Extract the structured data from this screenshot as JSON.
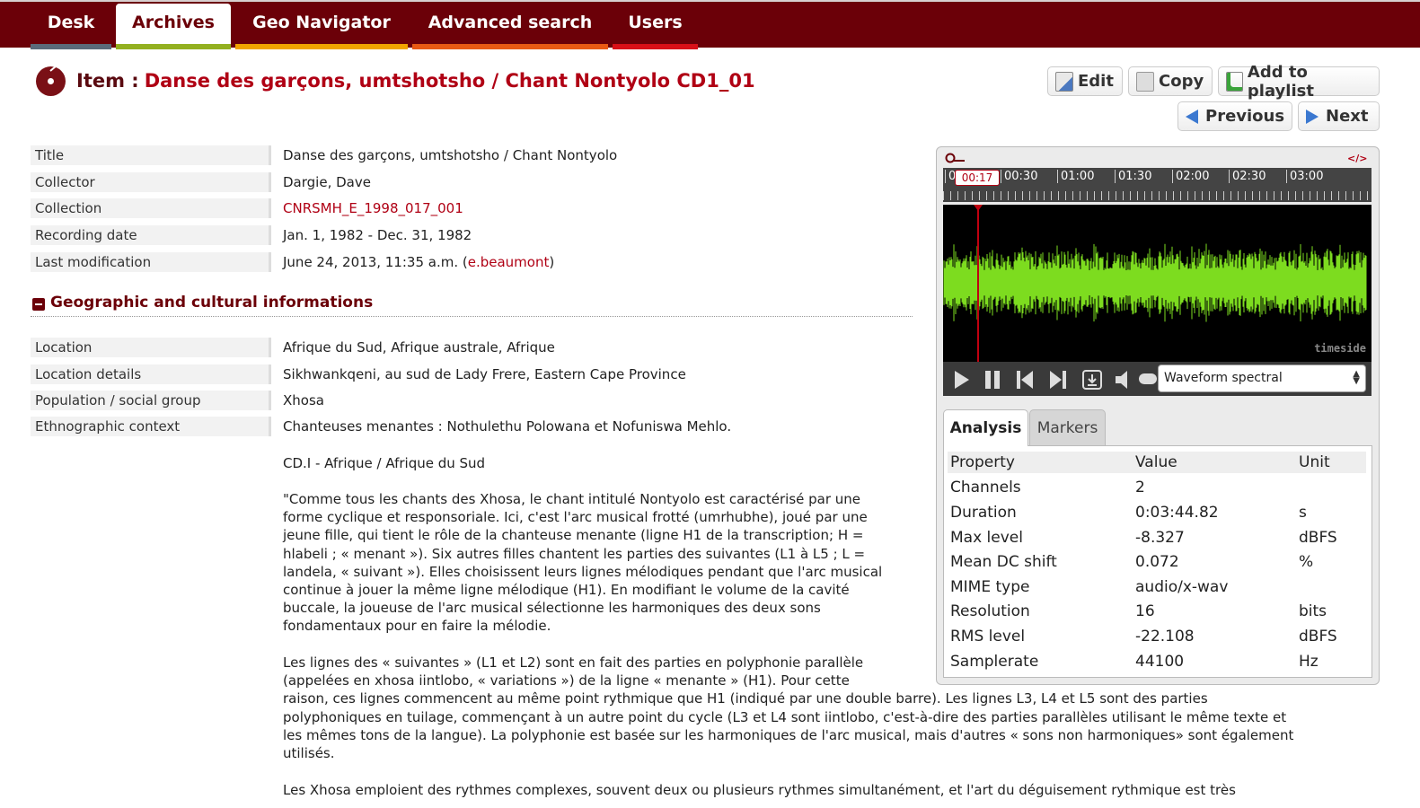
{
  "nav": {
    "tabs": [
      {
        "label": "Desk",
        "color": "#5b6b7b"
      },
      {
        "label": "Archives",
        "color": "#93b020"
      },
      {
        "label": "Geo Navigator",
        "color": "#f0a400"
      },
      {
        "label": "Advanced search",
        "color": "#e85a14"
      },
      {
        "label": "Users",
        "color": "#d81018"
      }
    ]
  },
  "item": {
    "label": "Item :",
    "title": "Danse des garçons, umtshotsho / Chant Nontyolo CD1_01"
  },
  "actions": {
    "edit": "Edit",
    "copy": "Copy",
    "add_to_playlist": "Add to playlist",
    "previous": "Previous",
    "next": "Next"
  },
  "metadata": [
    {
      "key": "Title",
      "value": "Danse des garçons, umtshotsho / Chant Nontyolo"
    },
    {
      "key": "Collector",
      "value": "Dargie, Dave"
    },
    {
      "key": "Collection",
      "value": "CNRSMH_E_1998_017_001"
    },
    {
      "key": "Recording date",
      "value": "Jan. 1, 1982 - Dec. 31, 1982"
    },
    {
      "key": "Last modification",
      "value_prefix": "June 24, 2013, 11:35 a.m. (",
      "value_link": "e.beaumont",
      "value_suffix": ")"
    }
  ],
  "geo_section": {
    "title": "Geographic and cultural informations",
    "rows": [
      {
        "key": "Location",
        "value": "Afrique du Sud, Afrique australe, Afrique"
      },
      {
        "key": "Location details",
        "value": "Sikhwankqeni, au sud de Lady Frere, Eastern Cape Province"
      },
      {
        "key": "Population / social group",
        "value": "Xhosa"
      },
      {
        "key": "Ethnographic context",
        "value": "Chanteuses menantes : Nothulethu Polowana et Nofuniswa Mehlo."
      }
    ]
  },
  "description": {
    "p1": "CD.I - Afrique / Afrique du Sud",
    "p2": [
      "\"Comme tous les chants des Xhosa, le chant intitulé Nontyolo est caractérisé par une",
      "forme cyclique et responsoriale. Ici, c'est l'arc musical frotté (umrhubhe), joué par une",
      "jeune fille, qui tient le rôle de la chanteuse menante (ligne H1 de la transcription; H =",
      "hlabeli ; « menant »). Six autres filles chantent les parties des suivantes (L1 à L5 ; L =",
      "landela, « suivant »). Elles choisissent leurs lignes mélodiques pendant que l'arc musical",
      "continue à jouer la même ligne mélodique (H1). En modifiant le volume de la cavité",
      "buccale, la joueuse de l'arc musical sélectionne les harmoniques des deux sons",
      "fondamentaux pour en faire la mélodie."
    ],
    "p3": [
      "Les lignes des « suivantes » (L1 et L2) sont en fait des parties en polyphonie parallèle",
      "(appelées en xhosa iintlobo, « variations ») de la ligne « menante » (H1). Pour cette",
      "raison, ces lignes commencent au même point rythmique que H1 (indiqué par une double barre). Les lignes L3, L4 et L5 sont des parties",
      "polyphoniques en tuilage, commençant à un autre point du cycle (L3 et L4 sont iintlobo, c'est-à-dire des parties parallèles utilisant le même texte et",
      "les mêmes tons de la langue). La polyphonie est basée sur les harmoniques de l'arc musical, mais d'autres « sons non harmoniques» sont également",
      "utilisés."
    ],
    "p4": "Les Xhosa emploient des rythmes complexes, souvent deux ou plusieurs rythmes simultanément, et l'art du déguisement rythmique est très"
  },
  "player": {
    "embed_label": "</>",
    "ruler_labels": [
      "0",
      "00:30",
      "01:00",
      "01:30",
      "02:00",
      "02:30",
      "03:00"
    ],
    "cursor_time": "00:17",
    "watermark": "timeside",
    "view_select": "Waveform spectral",
    "wave_color": "#7ddc1f",
    "tabs": {
      "analysis": "Analysis",
      "markers": "Markers"
    }
  },
  "analysis": {
    "headers": [
      "Property",
      "Value",
      "Unit"
    ],
    "rows": [
      [
        "Channels",
        "2",
        ""
      ],
      [
        "Duration",
        "0:03:44.82",
        "s"
      ],
      [
        "Max level",
        "-8.327",
        "dBFS"
      ],
      [
        "Mean DC shift",
        "0.072",
        "%"
      ],
      [
        "MIME type",
        "audio/x-wav",
        ""
      ],
      [
        "Resolution",
        "16",
        "bits"
      ],
      [
        "RMS level",
        "-22.108",
        "dBFS"
      ],
      [
        "Samplerate",
        "44100",
        "Hz"
      ]
    ]
  }
}
